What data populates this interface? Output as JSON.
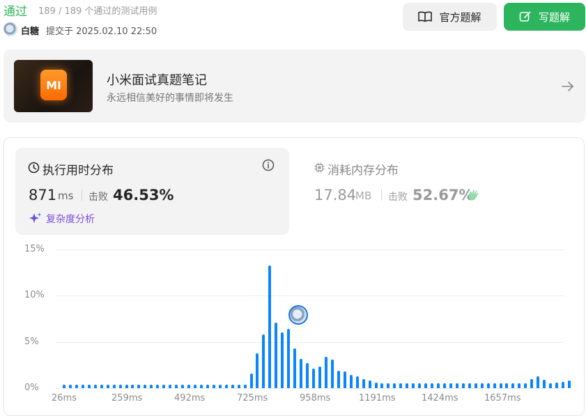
{
  "header": {
    "status": "通过",
    "cases": "189 / 189 个通过的测试用例",
    "username": "白糖",
    "submitted": "提交于 2025.02.10 22:50"
  },
  "buttons": {
    "official_solution": "官方题解",
    "write_solution": "写题解"
  },
  "card": {
    "title": "小米面试真题笔记",
    "subtitle": "永远相信美好的事情即将发生",
    "logo_text": "MI"
  },
  "runtime": {
    "title": "执行用时分布",
    "value": "871",
    "unit": "ms",
    "beat_label": "击败",
    "beat_pct": "46.53%",
    "complexity_link": "复杂度分析"
  },
  "memory": {
    "title": "消耗内存分布",
    "value": "17.84",
    "unit": "MB",
    "beat_label": "击败",
    "beat_pct": "52.67%"
  },
  "colors": {
    "accent_green": "#2db55d",
    "bar_blue": "#0a84ff",
    "complexity_purple": "#7a52d8"
  },
  "chart_data": {
    "type": "bar",
    "ylim": [
      0,
      15
    ],
    "ytick_labels": [
      "15%",
      "10%",
      "5%",
      "0%"
    ],
    "yticks": [
      15,
      10,
      5,
      0
    ],
    "xtick_labels": [
      "26ms",
      "259ms",
      "492ms",
      "725ms",
      "958ms",
      "1191ms",
      "1424ms",
      "1657ms"
    ],
    "grid": true,
    "values": [
      0.4,
      0.4,
      0.4,
      0.4,
      0.4,
      0.4,
      0.4,
      0.4,
      0.4,
      0.4,
      0.4,
      0.4,
      0.4,
      0.4,
      0.4,
      0.4,
      0.4,
      0.4,
      0.4,
      0.4,
      0.4,
      0.4,
      0.4,
      0.4,
      0.4,
      0.4,
      0.4,
      0.4,
      0.4,
      0.4,
      1.6,
      3.8,
      5.8,
      13.3,
      7.1,
      6.0,
      6.4,
      4.3,
      3.2,
      2.7,
      2.1,
      2.3,
      3.4,
      3.1,
      1.9,
      1.8,
      1.4,
      1.3,
      1.0,
      0.8,
      0.6,
      0.5,
      0.5,
      0.5,
      0.5,
      0.5,
      0.5,
      0.5,
      0.5,
      0.5,
      0.5,
      0.5,
      0.5,
      0.5,
      0.5,
      0.5,
      0.5,
      0.5,
      0.5,
      0.5,
      0.5,
      0.5,
      0.5,
      0.5,
      0.5,
      1.0,
      1.3,
      0.9,
      0.5,
      0.6,
      0.7,
      0.8
    ],
    "marker_index": 36
  }
}
